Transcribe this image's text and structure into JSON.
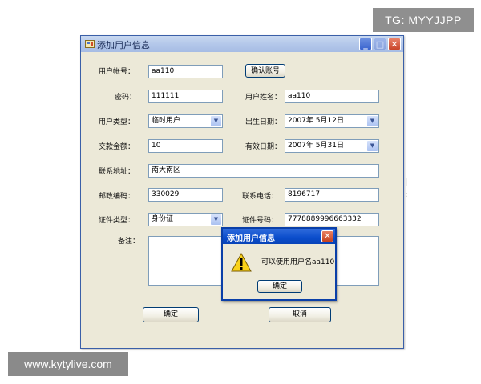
{
  "overlays": {
    "tg": "TG: MYYJJPP",
    "site": "www.kytylive.com"
  },
  "window": {
    "title": "添加用户信息",
    "controls": {
      "minimize": "_",
      "maximize": "□",
      "close": "✕"
    }
  },
  "form": {
    "account_label": "用户帐号：",
    "account_value": "aa110",
    "confirm_account_button": "确认账号",
    "password_label": "密码：",
    "password_value": "111111",
    "username_label": "用户姓名：",
    "username_value": "aa110",
    "user_type_label": "用户类型：",
    "user_type_value": "临时用户",
    "birth_date_label": "出生日期：",
    "birth_date_value": "2007年  5月12日",
    "amount_label": "交款金额：",
    "amount_value": "10",
    "valid_date_label": "有效日期：",
    "valid_date_value": "2007年  5月31日",
    "address_label": "联系地址：",
    "address_value": "南大南区",
    "postcode_label": "邮政编码：",
    "postcode_value": "330029",
    "phone_label": "联系电话：",
    "phone_value": "8196717",
    "id_type_label": "证件类型：",
    "id_type_value": "身份证",
    "id_number_label": "证件号码：",
    "id_number_value": "7778889996663332",
    "notes_label": "备注：",
    "notes_value": "",
    "ok_button": "确定",
    "cancel_button": "取消"
  },
  "dialog": {
    "title": "添加用户信息",
    "message": "可以使用用户名aa110",
    "ok_button": "确定",
    "close": "✕"
  },
  "colors": {
    "dialog_title": "#0a4ccb",
    "window_face": "#ece9d8",
    "window_title": "#b4c8ea"
  }
}
